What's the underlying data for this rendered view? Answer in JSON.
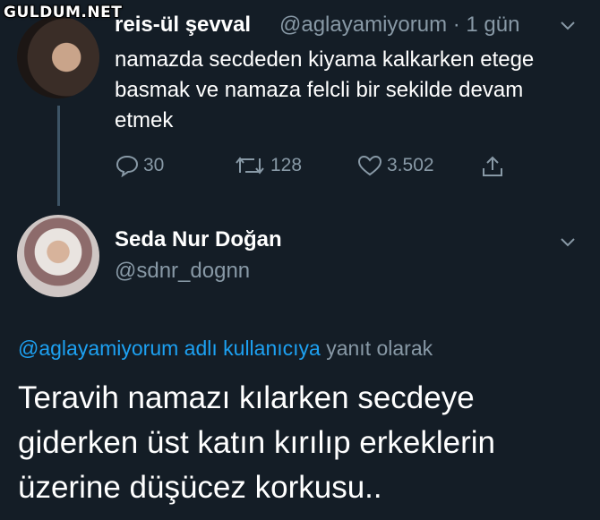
{
  "watermark": "GULDUM.NET",
  "tweet1": {
    "name": "reis-ül şevval",
    "handle_time": "@aglayamiyorum · 1 gün",
    "text": "namazda secdeden kiyama kalkarken etege basmak ve namaza felcli bir sekilde devam etmek",
    "replies": "30",
    "retweets": "128",
    "likes": "3.502"
  },
  "tweet2": {
    "name": "Seda Nur Doğan",
    "handle": "@sdnr_dognn",
    "reply_mention": "@aglayamiyorum adlı kullanıcıya",
    "reply_suffix": " yanıt olarak",
    "text": "Teravih namazı kılarken secdeye giderken üst katın kırılıp erkeklerin üzerine düşücez korkusu.."
  },
  "colors": {
    "background": "#141d26",
    "secondary": "#8899a6",
    "link": "#1da1f2"
  }
}
